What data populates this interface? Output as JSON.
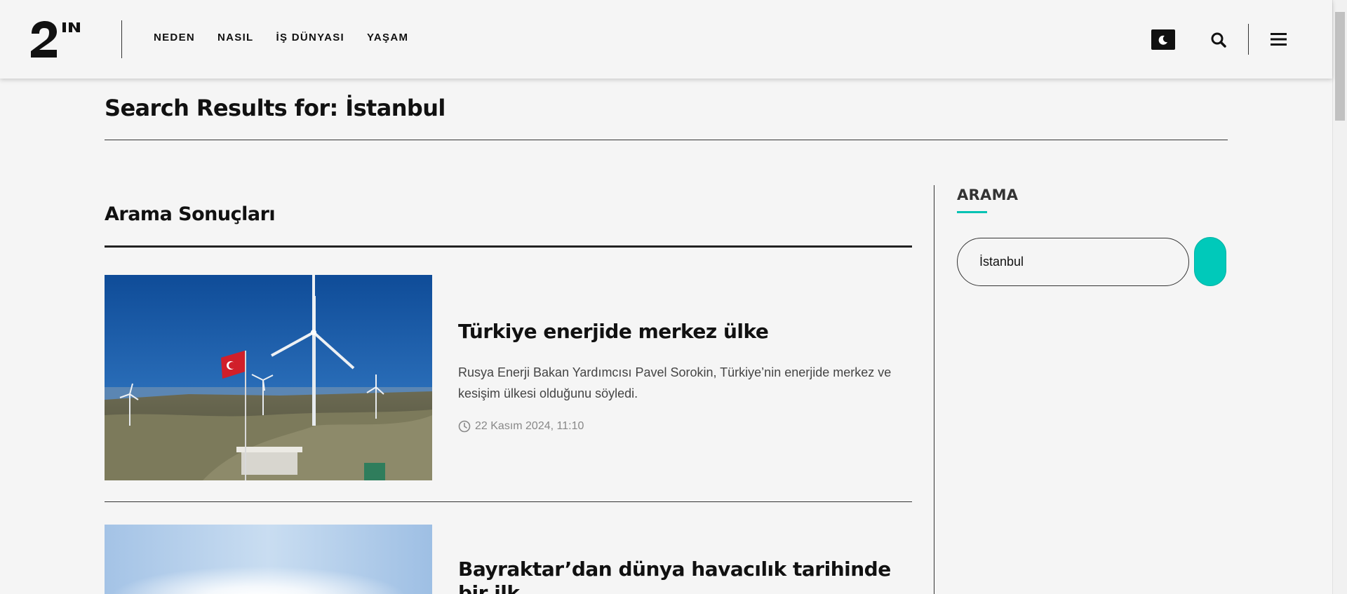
{
  "header": {
    "logo_text": "2N",
    "nav": [
      "NEDEN",
      "NASIL",
      "İŞ DÜNYASI",
      "YAŞAM"
    ],
    "icons": {
      "dark_mode": "moon-icon",
      "search": "search-icon",
      "menu": "hamburger-menu-icon"
    }
  },
  "page": {
    "title": "Search Results for: İstanbul"
  },
  "results": {
    "heading": "Arama Sonuçları",
    "articles": [
      {
        "title": "Türkiye enerjide merkez ülke",
        "excerpt": "Rusya Enerji Bakan Yardımcısı Pavel Sorokin, Türkiye’nin enerjide merkez ve kesişim ülkesi olduğunu söyledi.",
        "date": "22 Kasım 2024, 11:10",
        "image": "wind-turbines-turkish-flag"
      },
      {
        "title": "Bayraktar’dan dünya havacılık tarihinde bir ilk",
        "image": "sky-sun"
      }
    ]
  },
  "sidebar": {
    "title": "ARAMA",
    "search_value": "İstanbul"
  },
  "colors": {
    "accent": "#00c9ba",
    "background": "#f5f5f5",
    "text": "#111111"
  }
}
